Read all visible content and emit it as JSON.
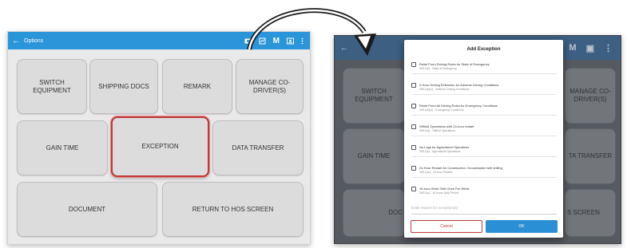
{
  "left_screen": {
    "topbar": {
      "back_glyph": "←",
      "title": "Options",
      "icons": [
        "camera-icon",
        "log-icon",
        "m-icon",
        "profile-icon",
        "more-icon"
      ],
      "m_label": "M"
    },
    "buttons": {
      "switch_equipment": "SWITCH EQUIPMENT",
      "shipping_docs": "SHIPPING DOCS",
      "remark": "REMARK",
      "manage_co_drivers": "MANAGE CO-DRIVER(S)",
      "gain_time": "GAIN TIME",
      "exception": "EXCEPTION",
      "data_transfer": "DATA TRANSFER",
      "document": "DOCUMENT",
      "return_to_hos": "RETURN TO HOS SCREEN"
    },
    "highlight_color": "#c0393b"
  },
  "right_screen": {
    "topbar": {
      "letters": [
        "D",
        "M"
      ]
    },
    "bg_buttons": {
      "switch_equipment": "SWITCH EQUIPMENT",
      "manage_co_drivers": "MANAGE CO-DRIVER(S)",
      "gain_time": "GAIN TIME",
      "data_transfer": "TA TRANSFER",
      "document": "DOC",
      "return_to_hos": "S SCREEN"
    }
  },
  "dialog": {
    "title": "Add Exception",
    "options": [
      {
        "label": "Relief From Driving Rules for State of Emergency",
        "sub": "395.1(b) - State of Emergency"
      },
      {
        "label": "2-Hour Driving Extension for Adverse Driving Conditions",
        "sub": "395.1(b)(1) - Adverse Driving Conditions"
      },
      {
        "label": "Relief From All Driving Rules for Emergency Conditions",
        "sub": "395.1(b)(2) - Emergency Conditions"
      },
      {
        "label": "Oilfield Operations with 24-hour restart",
        "sub": "395.1(d) - Oilfield Operations"
      },
      {
        "label": "No Logs for Agricultural Operations",
        "sub": "395.1(k) - Agricultural Operations"
      },
      {
        "label": "24-Hour Restart for Construction, Groundwater well drilling",
        "sub": "395.1(m) - 24-hour Restart"
      },
      {
        "label": "16-hour Work Shift Once Per Week",
        "sub": "395.1(o) - 16 hours Duty Period"
      }
    ],
    "reason_placeholder": "Enter reason for exception(s)",
    "cancel_label": "Cancel",
    "ok_label": "OK"
  },
  "colors": {
    "accent_blue": "#2b95d9",
    "cancel_red": "#c0393b",
    "arrow": "#1a1a1a"
  }
}
